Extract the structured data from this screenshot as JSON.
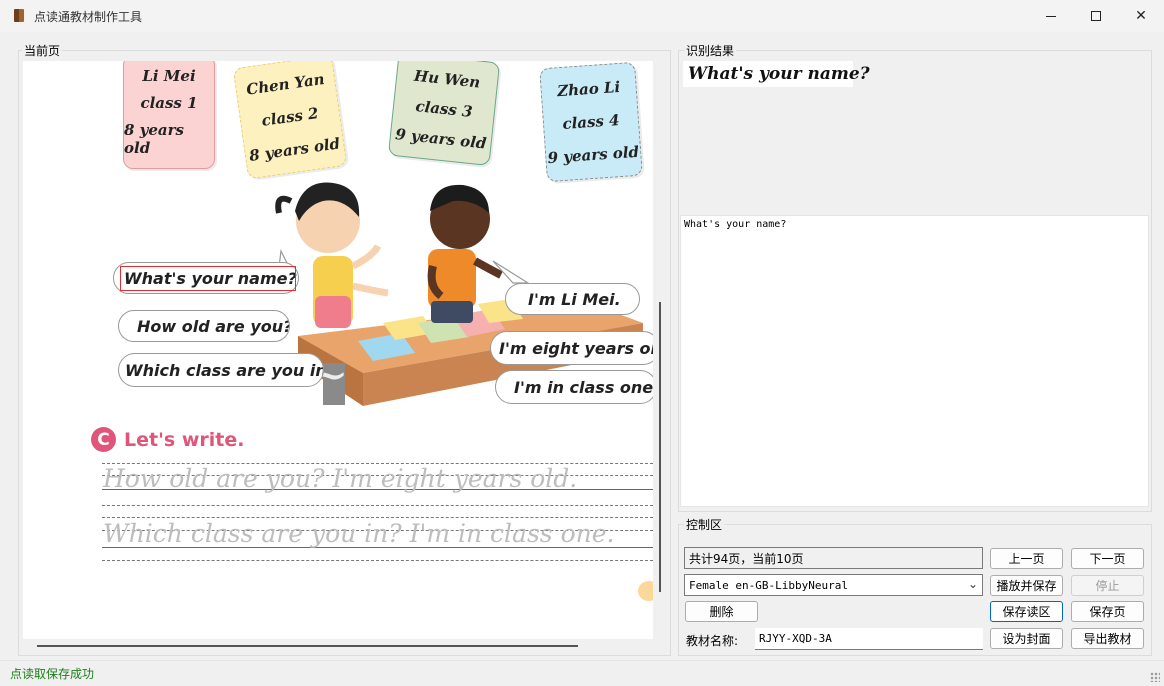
{
  "window": {
    "title": "点读通教材制作工具"
  },
  "current_page": {
    "label": "当前页",
    "cards": [
      {
        "lines": [
          "Li Mei",
          "class 1",
          "8 years old"
        ],
        "color": "#fcd3d3"
      },
      {
        "lines": [
          "Chen Yan",
          "class 2",
          "8 years old"
        ],
        "color": "#fdf2bf"
      },
      {
        "lines": [
          "Hu Wen",
          "class 3",
          "9 years old"
        ],
        "color": "#dfe8cf"
      },
      {
        "lines": [
          "Zhao Li",
          "class 4",
          "9 years old"
        ],
        "color": "#c9ebf7"
      }
    ],
    "bubbles_left": [
      "What's your name?",
      "How old are you?",
      "Which class are you in?"
    ],
    "bubbles_right": [
      "I'm  Li Mei.",
      "I'm eight years old",
      "I'm in class one."
    ],
    "section_letter": "C",
    "section_title": "Let's write.",
    "trace_lines": [
      "How old are you? I'm eight years old.",
      "Which class are you in? I'm in class one."
    ]
  },
  "recognition": {
    "label": "识别结果",
    "image_text": "What's your name?",
    "text": "What's your name?"
  },
  "control": {
    "label": "控制区",
    "page_info": "共计94页，当前10页",
    "voice_selected": "Female en-GB-LibbyNeural",
    "book_name_label": "教材名称:",
    "book_name_value": "RJYY-XQD-3A",
    "buttons": {
      "prev": "上一页",
      "next": "下一页",
      "play_save": "播放并保存",
      "stop": "停止",
      "delete": "删除",
      "save_area": "保存读区",
      "save_page": "保存页",
      "set_cover": "设为封面",
      "export": "导出教材"
    }
  },
  "status": {
    "text": "点读取保存成功"
  }
}
